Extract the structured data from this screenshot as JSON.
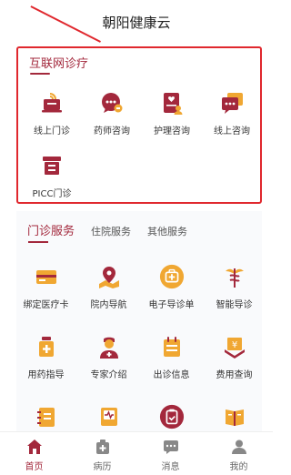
{
  "header": {
    "title": "朝阳健康云"
  },
  "internet_clinic": {
    "title": "互联网诊疗",
    "items": [
      {
        "label": "线上门诊",
        "icon": "laptop-wifi-icon"
      },
      {
        "label": "药师咨询",
        "icon": "chat-bubble-icon"
      },
      {
        "label": "护理咨询",
        "icon": "nurse-card-icon"
      },
      {
        "label": "线上咨询",
        "icon": "chat-stack-icon"
      },
      {
        "label": "PICC门诊",
        "icon": "picc-box-icon"
      }
    ]
  },
  "services": {
    "tabs": [
      {
        "label": "门诊服务",
        "active": true
      },
      {
        "label": "住院服务",
        "active": false
      },
      {
        "label": "其他服务",
        "active": false
      }
    ],
    "items": [
      {
        "label": "绑定医疗卡",
        "icon": "card-icon"
      },
      {
        "label": "院内导航",
        "icon": "map-pin-icon"
      },
      {
        "label": "电子导诊单",
        "icon": "medical-kit-icon"
      },
      {
        "label": "智能导诊",
        "icon": "caduceus-icon"
      },
      {
        "label": "用药指导",
        "icon": "medicine-bottle-icon"
      },
      {
        "label": "专家介绍",
        "icon": "doctor-icon"
      },
      {
        "label": "出诊信息",
        "icon": "calendar-icon"
      },
      {
        "label": "费用查询",
        "icon": "yen-icon"
      },
      {
        "label": "",
        "icon": "notebook-icon"
      },
      {
        "label": "",
        "icon": "heart-report-icon"
      },
      {
        "label": "",
        "icon": "clipboard-icon"
      },
      {
        "label": "",
        "icon": "book-icon"
      }
    ]
  },
  "bottom_nav": [
    {
      "label": "首页",
      "icon": "home-icon",
      "active": true
    },
    {
      "label": "病历",
      "icon": "medical-record-icon",
      "active": false
    },
    {
      "label": "消息",
      "icon": "message-icon",
      "active": false
    },
    {
      "label": "我的",
      "icon": "user-icon",
      "active": false
    }
  ],
  "colors": {
    "primary": "#a3283c",
    "accent": "#f0a732",
    "highlight": "#e0282e"
  }
}
